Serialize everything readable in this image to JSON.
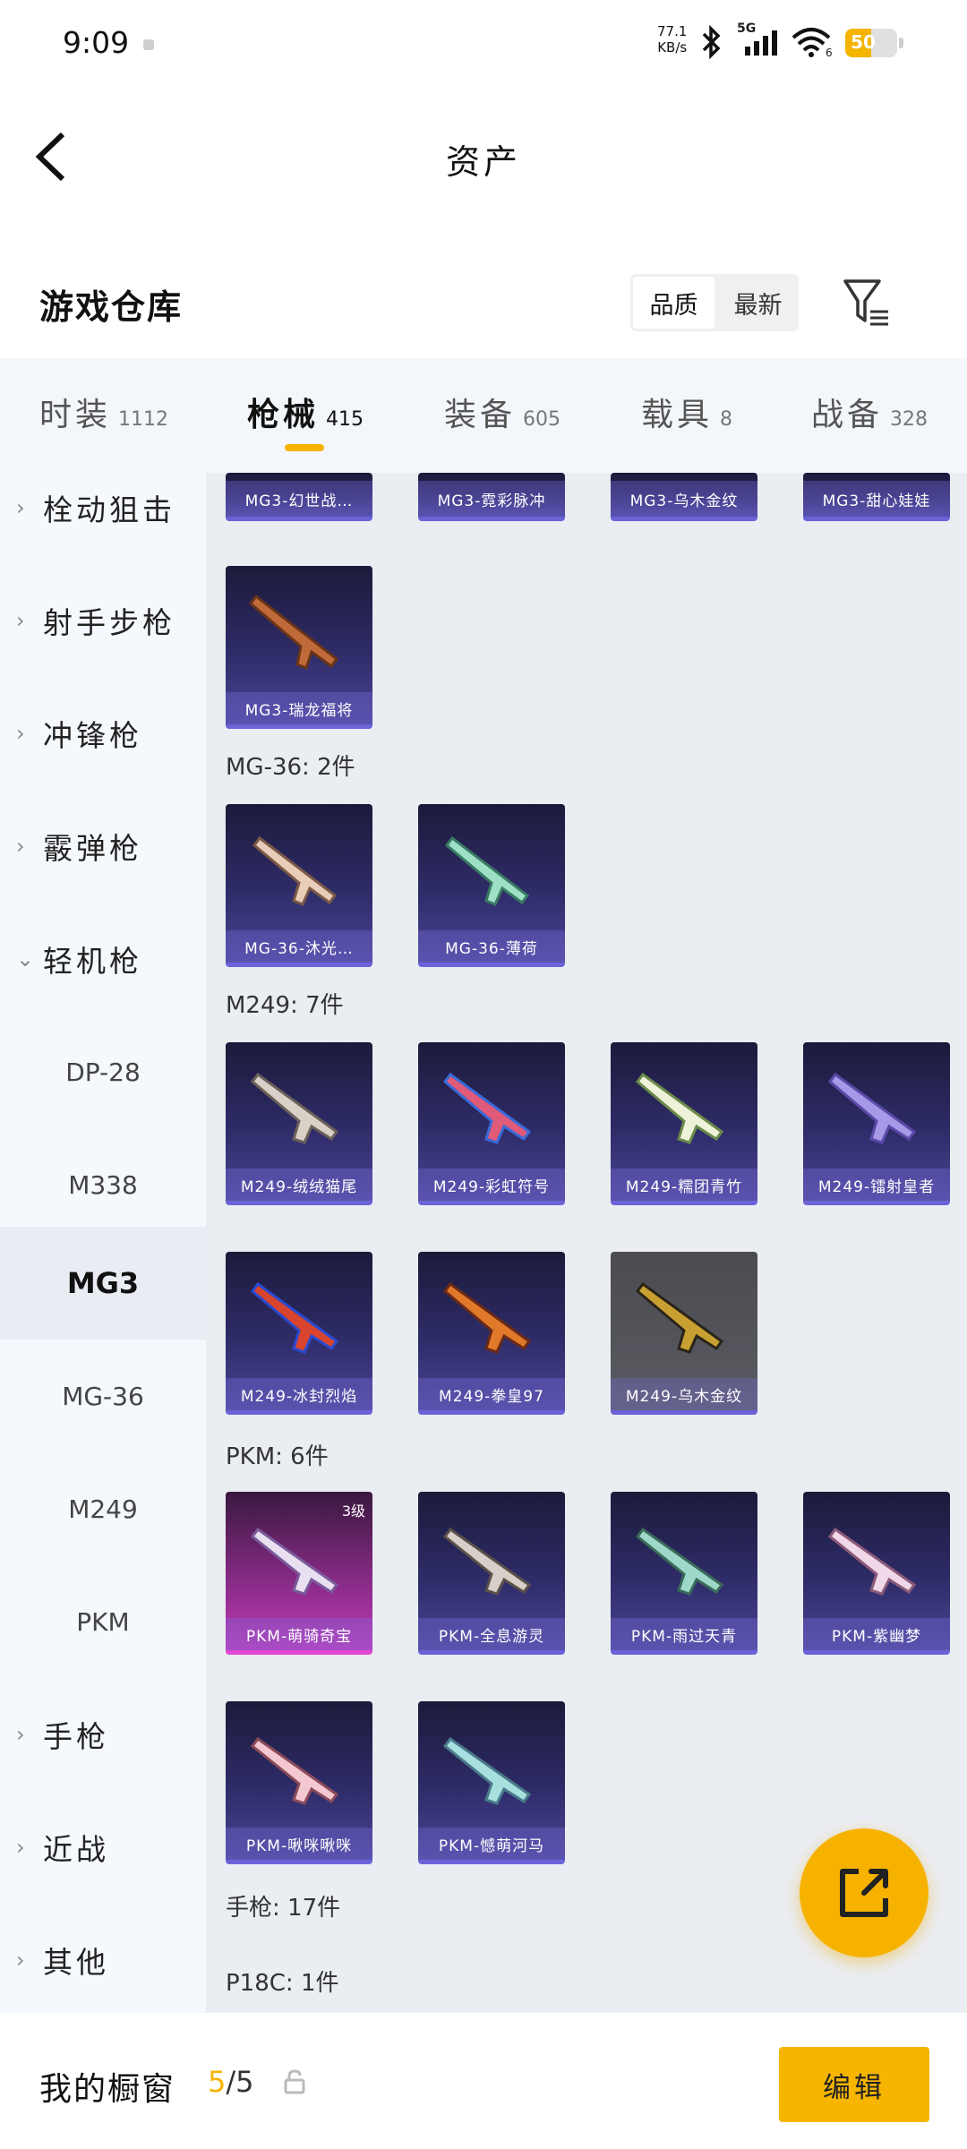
{
  "status_bar": {
    "time": "9:09",
    "net_speed_value": "77.1",
    "net_speed_unit": "KB/s",
    "network": "5G",
    "wifi_number": "6",
    "battery": "50",
    "battery_level": 0.5
  },
  "header": {
    "title": "资产"
  },
  "warehouse": {
    "title": "游戏仓库",
    "sort_quality": "品质",
    "sort_newest": "最新"
  },
  "tabs": [
    {
      "label": "时装",
      "count": "1112"
    },
    {
      "label": "枪械",
      "count": "415"
    },
    {
      "label": "装备",
      "count": "605"
    },
    {
      "label": "载具",
      "count": "8"
    },
    {
      "label": "战备",
      "count": "328"
    }
  ],
  "sidebar": {
    "categories": [
      "栓动狙击",
      "射手步枪",
      "冲锋枪",
      "霰弹枪",
      "轻机枪",
      "手枪",
      "近战",
      "其他"
    ],
    "subs": [
      "DP-28",
      "M338",
      "MG3",
      "MG-36",
      "M249",
      "PKM"
    ]
  },
  "content": {
    "top_row": [
      "MG3-幻世战…",
      "MG3-霓彩脉冲",
      "MG3-乌木金纹",
      "MG3-甜心娃娃"
    ],
    "mg3_extra": [
      "MG3-瑞龙福将"
    ],
    "mg36_header": "MG-36: 2件",
    "mg36": [
      "MG-36-沐光…",
      "MG-36-薄荷"
    ],
    "m249_header": "M249: 7件",
    "m249": [
      "M249-绒绒猫尾",
      "M249-彩虹符号",
      "M249-糯团青竹",
      "M249-镭射皇者",
      "M249-冰封烈焰",
      "M249-拳皇97",
      "M249-乌木金纹"
    ],
    "pkm_header": "PKM: 6件",
    "pkm": [
      "PKM-萌骑奇宝",
      "PKM-全息游灵",
      "PKM-雨过天青",
      "PKM-紫幽梦",
      "PKM-啾咪啾咪",
      "PKM-憾萌河马"
    ],
    "pkm_badge": "3级",
    "pistol_header": "手枪: 17件",
    "p18c_header": "P18C: 1件"
  },
  "bottom": {
    "label": "我的橱窗",
    "count_current": "5",
    "count_sep_total": "/5",
    "edit_label": "编辑"
  },
  "colors": {
    "accent": "#f7b500",
    "card_purple": "#2e2c68",
    "card_pink": "#c43ab8"
  }
}
